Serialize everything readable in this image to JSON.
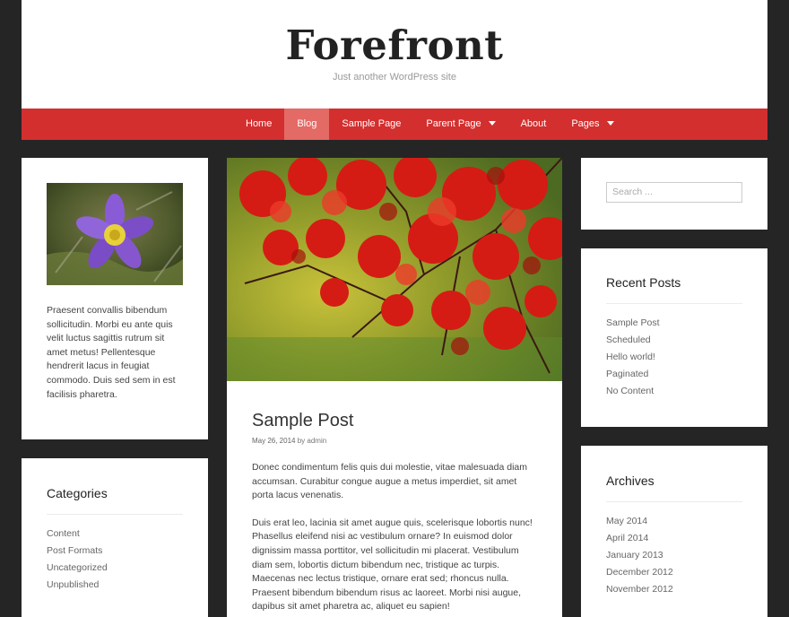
{
  "site": {
    "title": "Forefront",
    "description": "Just another WordPress site"
  },
  "nav": {
    "items": [
      {
        "label": "Home"
      },
      {
        "label": "Blog"
      },
      {
        "label": "Sample Page"
      },
      {
        "label": "Parent Page"
      },
      {
        "label": "About"
      },
      {
        "label": "Pages"
      }
    ],
    "active": "Blog",
    "color": "#d32f2f"
  },
  "left_sidebar": {
    "text_widget": {
      "image": "purple-pasque-flower",
      "text": "Praesent convallis bibendum sollicitudin. Morbi eu ante quis velit luctus sagittis rutrum sit amet metus! Pellentesque hendrerit lacus in feugiat commodo. Duis sed sem in est facilisis pharetra."
    },
    "categories": {
      "title": "Categories",
      "items": [
        "Content",
        "Post Formats",
        "Uncategorized",
        "Unpublished"
      ]
    }
  },
  "post": {
    "image": "red-japanese-maple",
    "title": "Sample Post",
    "date": "May 26, 2014",
    "by": "by",
    "author": "admin",
    "paragraphs": [
      "Donec condimentum felis quis dui molestie, vitae malesuada diam accumsan. Curabitur congue augue a metus imperdiet, sit amet porta lacus venenatis.",
      "Duis erat leo, lacinia sit amet augue quis, scelerisque lobortis nunc! Phasellus eleifend nisi ac vestibulum ornare? In euismod dolor dignissim massa porttitor, vel sollicitudin mi placerat. Vestibulum diam sem, lobortis dictum bibendum nec, tristique ac turpis. Maecenas nec lectus tristique, ornare erat sed; rhoncus nulla. Praesent bibendum bibendum risus ac laoreet. Morbi nisi augue, dapibus sit amet pharetra ac, aliquet eu sapien!"
    ]
  },
  "right_sidebar": {
    "search": {
      "placeholder": "Search ..."
    },
    "recent_posts": {
      "title": "Recent Posts",
      "items": [
        "Sample Post",
        "Scheduled",
        "Hello world!",
        "Paginated",
        "No Content"
      ]
    },
    "archives": {
      "title": "Archives",
      "items": [
        "May 2014",
        "April 2014",
        "January 2013",
        "December 2012",
        "November 2012"
      ]
    }
  }
}
